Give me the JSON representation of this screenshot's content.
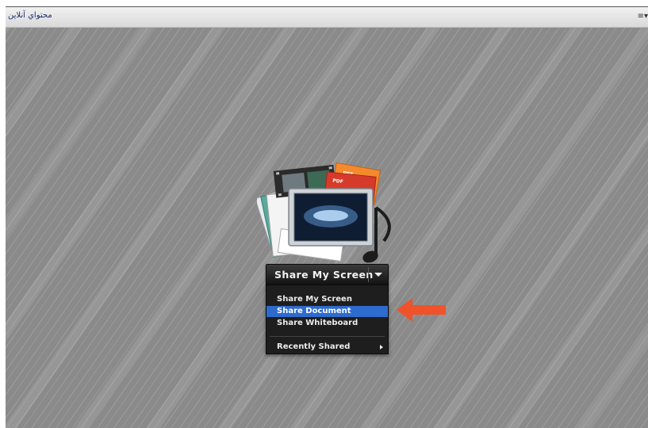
{
  "pod": {
    "title": "محتواي آنلاين",
    "menu_icon": "≡▾"
  },
  "share": {
    "button_label": "Share My Screen",
    "dropdown_icon": "chevron-down-icon",
    "graphic_labels": {
      "ppt": "PPT",
      "pdf": "PDF"
    }
  },
  "menu": {
    "items": [
      {
        "label": "Share My Screen",
        "selected": false
      },
      {
        "label": "Share Document",
        "selected": true
      },
      {
        "label": "Share Whiteboard",
        "selected": false
      }
    ],
    "recent_label": "Recently Shared"
  },
  "colors": {
    "selected_item": "#2d6bcd",
    "pointer_arrow": "#f0522a",
    "stage_gray": "#8a8a8a"
  }
}
